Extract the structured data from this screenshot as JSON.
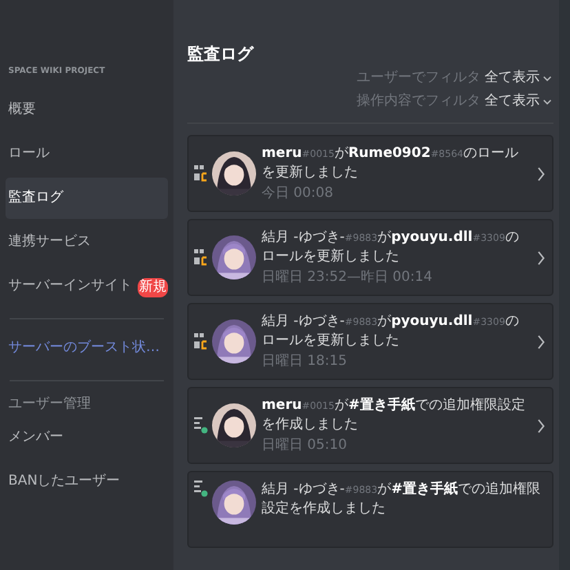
{
  "sidebar": {
    "header": "SPACE WIKI PROJECT",
    "items": [
      {
        "label": "概要",
        "kind": "item",
        "selected": false
      },
      {
        "label": "ロール",
        "kind": "item",
        "selected": false
      },
      {
        "label": "監査ログ",
        "kind": "item",
        "selected": true
      },
      {
        "label": "連携サービス",
        "kind": "item",
        "selected": false
      },
      {
        "label": "サーバーインサイト",
        "kind": "item",
        "selected": false,
        "badge": "新規"
      },
      {
        "kind": "divider"
      },
      {
        "label": "サーバーのブースト状…",
        "kind": "link"
      },
      {
        "kind": "divider"
      },
      {
        "label": "ユーザー管理",
        "kind": "section"
      },
      {
        "label": "メンバー",
        "kind": "item",
        "selected": false
      },
      {
        "label": "BANしたユーザー",
        "kind": "item",
        "selected": false
      }
    ]
  },
  "page": {
    "title": "監査ログ",
    "filters": [
      {
        "label": "ユーザーでフィルタ",
        "value": "全て表示"
      },
      {
        "label": "操作内容でフィルタ",
        "value": "全て表示"
      }
    ]
  },
  "entries": [
    {
      "kind": "update",
      "parts": [
        {
          "kind": "name",
          "text": "meru"
        },
        {
          "kind": "tag",
          "text": "#0015"
        },
        {
          "kind": "plain",
          "text": "が"
        },
        {
          "kind": "name",
          "text": "Rume0902"
        },
        {
          "kind": "tag",
          "text": "#8564"
        },
        {
          "kind": "plain",
          "text": "のロールを更新しました"
        }
      ],
      "time": "今日 00:08"
    },
    {
      "kind": "update",
      "parts": [
        {
          "kind": "plain",
          "text": "結月 -ゆづき-"
        },
        {
          "kind": "tag",
          "text": "#9883"
        },
        {
          "kind": "plain",
          "text": "が"
        },
        {
          "kind": "name",
          "text": "pyouyu.dll"
        },
        {
          "kind": "tag",
          "text": "#3309"
        },
        {
          "kind": "plain",
          "text": "のロールを更新しました"
        }
      ],
      "time": "日曜日 23:52—昨日 00:14"
    },
    {
      "kind": "update",
      "parts": [
        {
          "kind": "plain",
          "text": "結月 -ゆづき-"
        },
        {
          "kind": "tag",
          "text": "#9883"
        },
        {
          "kind": "plain",
          "text": "が"
        },
        {
          "kind": "name",
          "text": "pyouyu.dll"
        },
        {
          "kind": "tag",
          "text": "#3309"
        },
        {
          "kind": "plain",
          "text": "のロールを更新しました"
        }
      ],
      "time": "日曜日 18:15"
    },
    {
      "kind": "create",
      "parts": [
        {
          "kind": "name",
          "text": "meru"
        },
        {
          "kind": "tag",
          "text": "#0015"
        },
        {
          "kind": "plain",
          "text": "が"
        },
        {
          "kind": "name",
          "text": "#置き手紙"
        },
        {
          "kind": "plain",
          "text": "での追加権限設定を作成しました"
        }
      ],
      "time": "日曜日 05:10"
    },
    {
      "kind": "create",
      "parts": [
        {
          "kind": "plain",
          "text": "結月 -ゆづき-"
        },
        {
          "kind": "tag",
          "text": "#9883"
        },
        {
          "kind": "plain",
          "text": "が"
        },
        {
          "kind": "name",
          "text": "#置き手紙"
        },
        {
          "kind": "plain",
          "text": "での追加権限設定を作成しました"
        }
      ]
    }
  ]
}
